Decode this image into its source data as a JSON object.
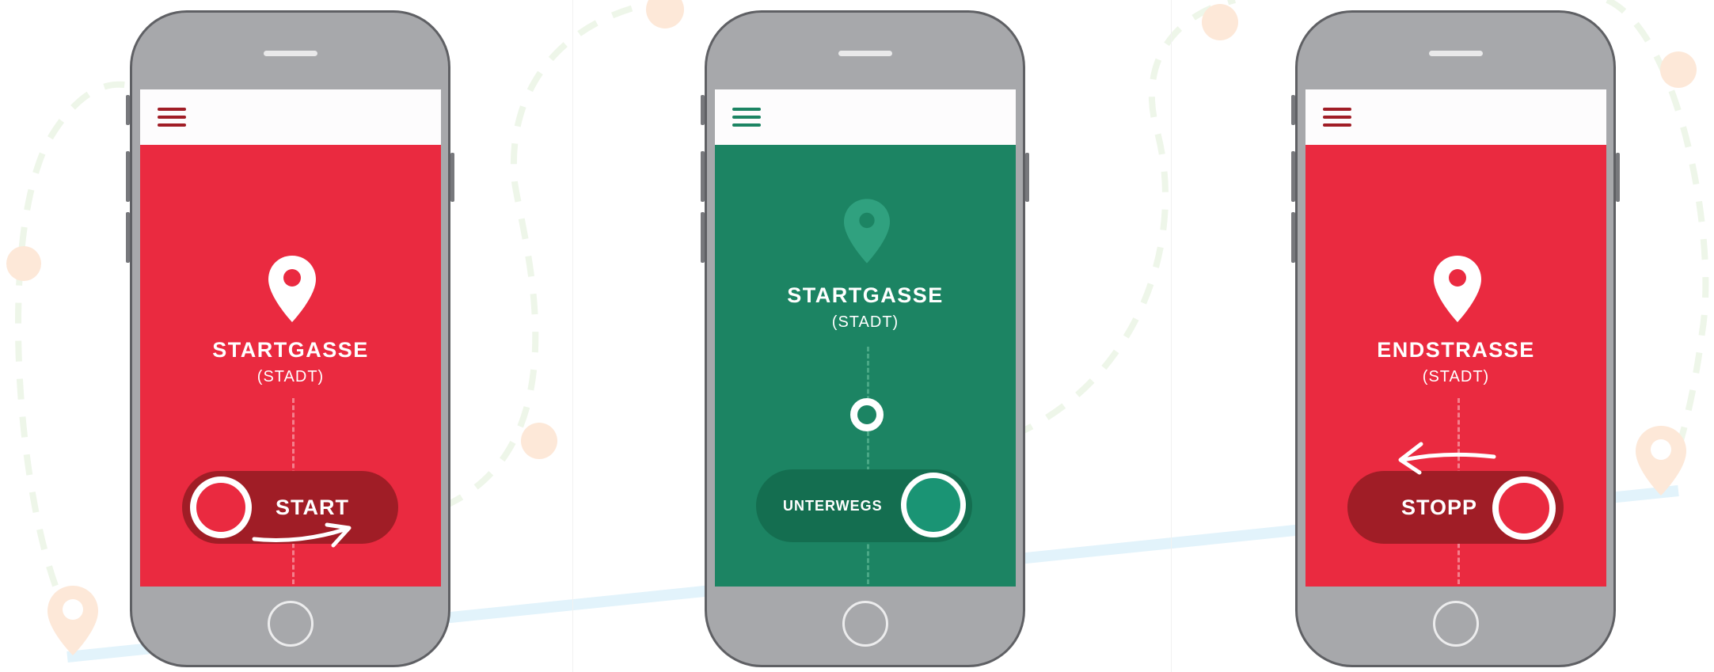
{
  "colors": {
    "red": "#ea2a40",
    "dark_red": "#a01d26",
    "green": "#1c8463",
    "dark_green": "#146e50",
    "teal_knob": "#1a9474",
    "phone_body": "#a7a8ab",
    "route_line": "#e2f3fb",
    "route_dots": "#fde8d8",
    "dashed_route": "#eef6e9"
  },
  "screens": [
    {
      "state": "ready",
      "menu_icon": "hamburger-icon",
      "pin_icon": "map-pin-icon",
      "place_name": "STARTGASSE",
      "place_city": "(STADT)",
      "toggle_label": "START",
      "gesture": "swipe-right-arrow"
    },
    {
      "state": "underway",
      "menu_icon": "hamburger-icon",
      "pin_icon": "map-pin-icon",
      "place_name": "STARTGASSE",
      "place_city": "(STADT)",
      "toggle_label": "UNTERWEGS",
      "marker_icon": "position-ring-icon"
    },
    {
      "state": "stop",
      "menu_icon": "hamburger-icon",
      "pin_icon": "map-pin-icon",
      "place_name": "ENDSTRASSE",
      "place_city": "(STADT)",
      "toggle_label": "STOPP",
      "gesture": "swipe-left-arrow"
    }
  ]
}
